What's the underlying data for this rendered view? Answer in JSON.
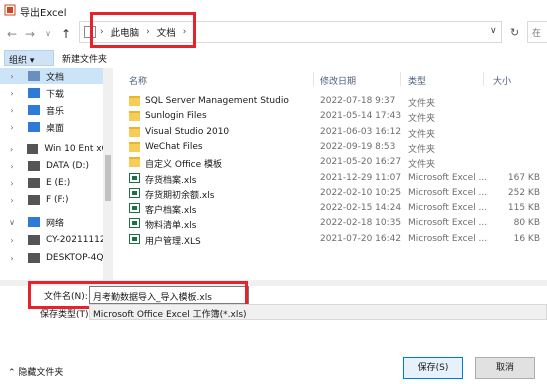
{
  "window": {
    "title": "导出Excel"
  },
  "nav": {
    "back": "←",
    "forward": "→",
    "dropdown": "∨",
    "up": "↑"
  },
  "address": {
    "crumbs": [
      "此电脑",
      "文档"
    ],
    "sep": "›",
    "dropdown": "∨",
    "refresh": "↻",
    "search_placeholder": "在"
  },
  "toolbar": {
    "organize": "组织 ▾",
    "new_folder": "新建文件夹"
  },
  "sidebar": {
    "items": [
      {
        "label": "文档",
        "chev": "›",
        "icon": "documents-icon",
        "color": "#6a8fbf",
        "selected": true
      },
      {
        "label": "下载",
        "chev": "›",
        "icon": "download-icon",
        "color": "#2d7bd6"
      },
      {
        "label": "音乐",
        "chev": "›",
        "icon": "music-icon",
        "color": "#2d7bd6"
      },
      {
        "label": "桌面",
        "chev": "›",
        "icon": "desktop-icon",
        "color": "#2d7bd6"
      },
      {
        "label": "Win 10 Ent x64",
        "chev": "›",
        "icon": "drive-icon",
        "color": "#555555"
      },
      {
        "label": "DATA (D:)",
        "chev": "›",
        "icon": "drive-icon",
        "color": "#555555"
      },
      {
        "label": "E (E:)",
        "chev": "›",
        "icon": "drive-icon",
        "color": "#555555"
      },
      {
        "label": "F (F:)",
        "chev": "›",
        "icon": "drive-icon",
        "color": "#555555"
      },
      {
        "label": "网络",
        "chev": "∨",
        "icon": "network-icon",
        "color": "#2d7bd6"
      },
      {
        "label": "CY-20211112U",
        "chev": "›",
        "icon": "computer-icon",
        "color": "#555555"
      },
      {
        "label": "DESKTOP-4QI0",
        "chev": "›",
        "icon": "computer-icon",
        "color": "#555555"
      }
    ]
  },
  "columns": {
    "name": "名称",
    "date": "修改日期",
    "type": "类型",
    "size": "大小"
  },
  "files": [
    {
      "name": "SQL Server Management Studio",
      "date": "2022-07-18 9:37",
      "type": "文件夹",
      "size": "",
      "kind": "folder"
    },
    {
      "name": "Sunlogin Files",
      "date": "2021-05-14 17:43",
      "type": "文件夹",
      "size": "",
      "kind": "folder"
    },
    {
      "name": "Visual Studio 2010",
      "date": "2021-06-03 16:12",
      "type": "文件夹",
      "size": "",
      "kind": "folder"
    },
    {
      "name": "WeChat Files",
      "date": "2022-09-19 8:53",
      "type": "文件夹",
      "size": "",
      "kind": "folder"
    },
    {
      "name": "自定义 Office 模板",
      "date": "2021-05-20 16:27",
      "type": "文件夹",
      "size": "",
      "kind": "folder"
    },
    {
      "name": "存货档案.xls",
      "date": "2021-12-29 11:07",
      "type": "Microsoft Excel ...",
      "size": "167 KB",
      "kind": "xls"
    },
    {
      "name": "存货期初余额.xls",
      "date": "2022-02-10 10:25",
      "type": "Microsoft Excel ...",
      "size": "252 KB",
      "kind": "xls"
    },
    {
      "name": "客户档案.xls",
      "date": "2022-02-15 14:24",
      "type": "Microsoft Excel ...",
      "size": "115 KB",
      "kind": "xls"
    },
    {
      "name": "物料清单.xls",
      "date": "2022-02-18 10:35",
      "type": "Microsoft Excel ...",
      "size": "80 KB",
      "kind": "xls"
    },
    {
      "name": "用户管理.XLS",
      "date": "2021-07-20 16:42",
      "type": "Microsoft Excel ...",
      "size": "16 KB",
      "kind": "xls"
    }
  ],
  "form": {
    "filename_label": "文件名(N):",
    "filename_value": "月考勤数据导入_导入模板.xls",
    "type_label": "保存类型(T):",
    "type_value": "Microsoft Office Excel 工作簿(*.xls)"
  },
  "footer": {
    "hide_folders": "⌃  隐藏文件夹",
    "save": "保存(S)",
    "cancel": "取消"
  }
}
